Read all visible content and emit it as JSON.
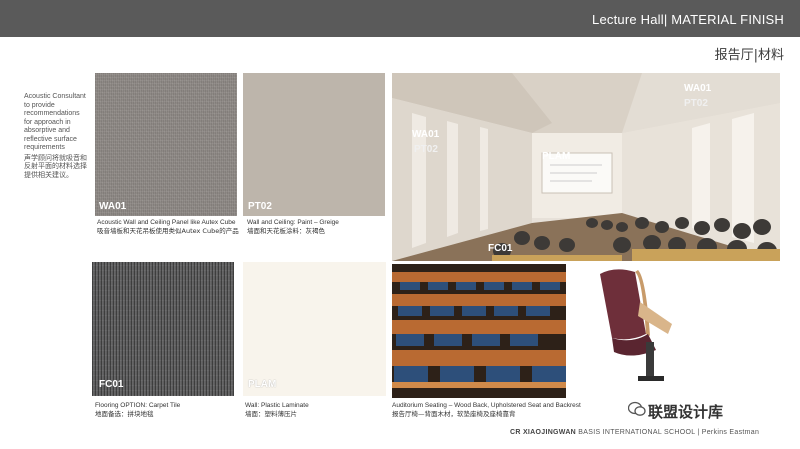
{
  "header": {
    "title": "Lecture Hall|  MATERIAL FINISH",
    "subtitle_cn": "报告厅|材料"
  },
  "note": {
    "en": "Acoustic Consultant to provide recommendations for approach in absorptive and reflective surface requirements",
    "cn": "声学顾问将就吸音和反射平面的材料选择提供相关建议。"
  },
  "swatches": {
    "wa01": {
      "code": "WA01",
      "caption_en": "Acoustic Wall and Ceiling Panel like Autex Cube",
      "caption_cn": "吸音墙板和天花吊板使用类似Autex Cube的产品"
    },
    "pt02": {
      "code": "PT02",
      "caption_en": "Wall and Ceiling: Paint – Greige",
      "caption_cn": "墙面和天花板涂料：灰褐色"
    },
    "fc01": {
      "code": "FC01",
      "caption_en": "Flooring OPTION: Carpet Tile",
      "caption_cn": "地面备选：拼块地毯"
    },
    "plam": {
      "code": "PLAM",
      "caption_en": "Wall: Plastic Laminate",
      "caption_cn": "墙面：塑料薄压片"
    },
    "seating": {
      "caption_en": "Auditorium Seating – Wood Back, Upholstered Seat and Backrest",
      "caption_cn": "报告厅椅—背面木材，软垫座椅及座椅靠背"
    }
  },
  "hall_labels": {
    "wa01_right": "WA01",
    "pt02_right": "PT02",
    "wa01_left": "WA01",
    "pt02_left": "PT02",
    "plam": "PLAM",
    "fc01": "FC01"
  },
  "footer": {
    "brand": "CR XIAOJINGWAN",
    "school": " BASIS INTERNATIONAL SCHOOL",
    "firm": " | Perkins Eastman"
  },
  "watermark": "联盟设计库",
  "colors": {
    "topbar": "#5a5a5a",
    "wa01": "#8d8884",
    "pt02": "#bdb5ab",
    "fc01": "#5d5d5e",
    "plam": "#f8f4ec"
  }
}
